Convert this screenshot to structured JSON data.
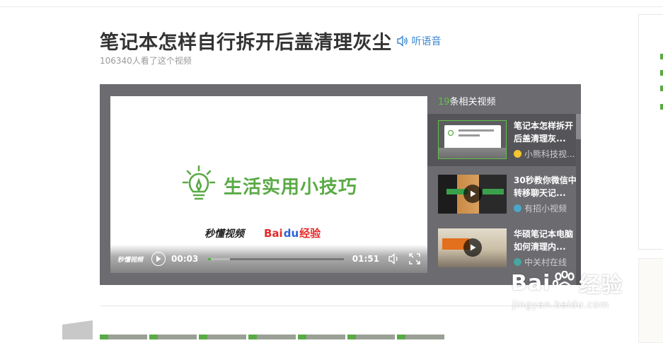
{
  "article": {
    "title": "笔记本怎样自行拆开后盖清理灰尘",
    "listen_label": "听语音",
    "views_text": "106340人看了这个视频"
  },
  "video": {
    "brand_text": "生活实用小技巧",
    "qd_logo": "秒懂视频",
    "baidu_logo": {
      "bai": "Bai",
      "paw": "du",
      "jy": "经验"
    },
    "controls_watermark": "秒懂视频",
    "current_time": "00:03",
    "duration": "01:51",
    "progress_played": 0.02,
    "progress_buffered": 0.16
  },
  "related": {
    "count": "19",
    "heading_suffix": "条相关视频",
    "items": [
      {
        "title": "笔记本怎样拆开后盖清理灰...",
        "source": "小熊科技视...",
        "active": true,
        "src_color": "#f3c531"
      },
      {
        "title": "30秒教你微信中转移聊天记...",
        "source": "有招小视频",
        "active": false,
        "src_color": "#4aa7c9"
      },
      {
        "title": "华硕笔记本电脑如何清理内...",
        "source": "中关村在线",
        "active": false,
        "src_color": "#4aa5a0"
      }
    ]
  },
  "steps": [
    "1",
    "2",
    "3",
    "4",
    "5",
    "6",
    "7"
  ],
  "watermark": {
    "text_bai": "Bai",
    "text_jy": "经验",
    "url": "jingyan.baidu.com"
  },
  "colors": {
    "green": "#5aaa45",
    "link": "#3b86d1",
    "player_bg": "#6b6b70"
  }
}
